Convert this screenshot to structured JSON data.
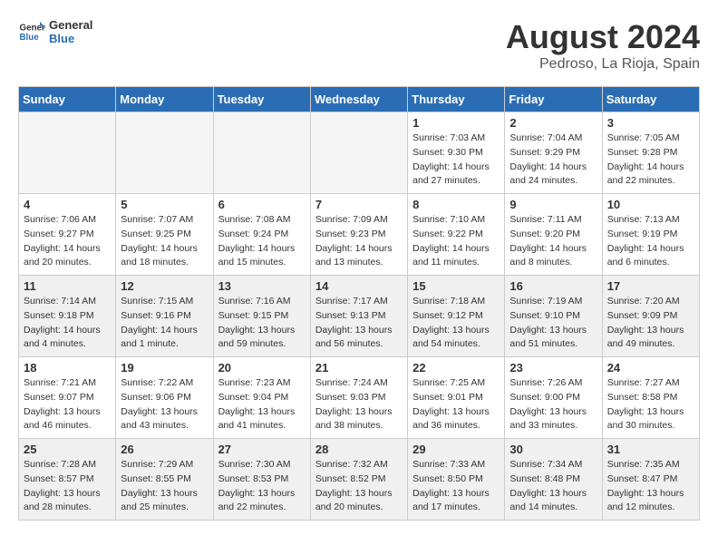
{
  "header": {
    "logo_general": "General",
    "logo_blue": "Blue",
    "title": "August 2024",
    "location": "Pedroso, La Rioja, Spain"
  },
  "weekdays": [
    "Sunday",
    "Monday",
    "Tuesday",
    "Wednesday",
    "Thursday",
    "Friday",
    "Saturday"
  ],
  "weeks": [
    [
      {
        "day": "",
        "empty": true
      },
      {
        "day": "",
        "empty": true
      },
      {
        "day": "",
        "empty": true
      },
      {
        "day": "",
        "empty": true
      },
      {
        "day": "1",
        "lines": [
          "Sunrise: 7:03 AM",
          "Sunset: 9:30 PM",
          "Daylight: 14 hours",
          "and 27 minutes."
        ]
      },
      {
        "day": "2",
        "lines": [
          "Sunrise: 7:04 AM",
          "Sunset: 9:29 PM",
          "Daylight: 14 hours",
          "and 24 minutes."
        ]
      },
      {
        "day": "3",
        "lines": [
          "Sunrise: 7:05 AM",
          "Sunset: 9:28 PM",
          "Daylight: 14 hours",
          "and 22 minutes."
        ]
      }
    ],
    [
      {
        "day": "4",
        "lines": [
          "Sunrise: 7:06 AM",
          "Sunset: 9:27 PM",
          "Daylight: 14 hours",
          "and 20 minutes."
        ]
      },
      {
        "day": "5",
        "lines": [
          "Sunrise: 7:07 AM",
          "Sunset: 9:25 PM",
          "Daylight: 14 hours",
          "and 18 minutes."
        ]
      },
      {
        "day": "6",
        "lines": [
          "Sunrise: 7:08 AM",
          "Sunset: 9:24 PM",
          "Daylight: 14 hours",
          "and 15 minutes."
        ]
      },
      {
        "day": "7",
        "lines": [
          "Sunrise: 7:09 AM",
          "Sunset: 9:23 PM",
          "Daylight: 14 hours",
          "and 13 minutes."
        ]
      },
      {
        "day": "8",
        "lines": [
          "Sunrise: 7:10 AM",
          "Sunset: 9:22 PM",
          "Daylight: 14 hours",
          "and 11 minutes."
        ]
      },
      {
        "day": "9",
        "lines": [
          "Sunrise: 7:11 AM",
          "Sunset: 9:20 PM",
          "Daylight: 14 hours",
          "and 8 minutes."
        ]
      },
      {
        "day": "10",
        "lines": [
          "Sunrise: 7:13 AM",
          "Sunset: 9:19 PM",
          "Daylight: 14 hours",
          "and 6 minutes."
        ]
      }
    ],
    [
      {
        "day": "11",
        "lines": [
          "Sunrise: 7:14 AM",
          "Sunset: 9:18 PM",
          "Daylight: 14 hours",
          "and 4 minutes."
        ]
      },
      {
        "day": "12",
        "lines": [
          "Sunrise: 7:15 AM",
          "Sunset: 9:16 PM",
          "Daylight: 14 hours",
          "and 1 minute."
        ]
      },
      {
        "day": "13",
        "lines": [
          "Sunrise: 7:16 AM",
          "Sunset: 9:15 PM",
          "Daylight: 13 hours",
          "and 59 minutes."
        ]
      },
      {
        "day": "14",
        "lines": [
          "Sunrise: 7:17 AM",
          "Sunset: 9:13 PM",
          "Daylight: 13 hours",
          "and 56 minutes."
        ]
      },
      {
        "day": "15",
        "lines": [
          "Sunrise: 7:18 AM",
          "Sunset: 9:12 PM",
          "Daylight: 13 hours",
          "and 54 minutes."
        ]
      },
      {
        "day": "16",
        "lines": [
          "Sunrise: 7:19 AM",
          "Sunset: 9:10 PM",
          "Daylight: 13 hours",
          "and 51 minutes."
        ]
      },
      {
        "day": "17",
        "lines": [
          "Sunrise: 7:20 AM",
          "Sunset: 9:09 PM",
          "Daylight: 13 hours",
          "and 49 minutes."
        ]
      }
    ],
    [
      {
        "day": "18",
        "lines": [
          "Sunrise: 7:21 AM",
          "Sunset: 9:07 PM",
          "Daylight: 13 hours",
          "and 46 minutes."
        ]
      },
      {
        "day": "19",
        "lines": [
          "Sunrise: 7:22 AM",
          "Sunset: 9:06 PM",
          "Daylight: 13 hours",
          "and 43 minutes."
        ]
      },
      {
        "day": "20",
        "lines": [
          "Sunrise: 7:23 AM",
          "Sunset: 9:04 PM",
          "Daylight: 13 hours",
          "and 41 minutes."
        ]
      },
      {
        "day": "21",
        "lines": [
          "Sunrise: 7:24 AM",
          "Sunset: 9:03 PM",
          "Daylight: 13 hours",
          "and 38 minutes."
        ]
      },
      {
        "day": "22",
        "lines": [
          "Sunrise: 7:25 AM",
          "Sunset: 9:01 PM",
          "Daylight: 13 hours",
          "and 36 minutes."
        ]
      },
      {
        "day": "23",
        "lines": [
          "Sunrise: 7:26 AM",
          "Sunset: 9:00 PM",
          "Daylight: 13 hours",
          "and 33 minutes."
        ]
      },
      {
        "day": "24",
        "lines": [
          "Sunrise: 7:27 AM",
          "Sunset: 8:58 PM",
          "Daylight: 13 hours",
          "and 30 minutes."
        ]
      }
    ],
    [
      {
        "day": "25",
        "lines": [
          "Sunrise: 7:28 AM",
          "Sunset: 8:57 PM",
          "Daylight: 13 hours",
          "and 28 minutes."
        ]
      },
      {
        "day": "26",
        "lines": [
          "Sunrise: 7:29 AM",
          "Sunset: 8:55 PM",
          "Daylight: 13 hours",
          "and 25 minutes."
        ]
      },
      {
        "day": "27",
        "lines": [
          "Sunrise: 7:30 AM",
          "Sunset: 8:53 PM",
          "Daylight: 13 hours",
          "and 22 minutes."
        ]
      },
      {
        "day": "28",
        "lines": [
          "Sunrise: 7:32 AM",
          "Sunset: 8:52 PM",
          "Daylight: 13 hours",
          "and 20 minutes."
        ]
      },
      {
        "day": "29",
        "lines": [
          "Sunrise: 7:33 AM",
          "Sunset: 8:50 PM",
          "Daylight: 13 hours",
          "and 17 minutes."
        ]
      },
      {
        "day": "30",
        "lines": [
          "Sunrise: 7:34 AM",
          "Sunset: 8:48 PM",
          "Daylight: 13 hours",
          "and 14 minutes."
        ]
      },
      {
        "day": "31",
        "lines": [
          "Sunrise: 7:35 AM",
          "Sunset: 8:47 PM",
          "Daylight: 13 hours",
          "and 12 minutes."
        ]
      }
    ]
  ]
}
